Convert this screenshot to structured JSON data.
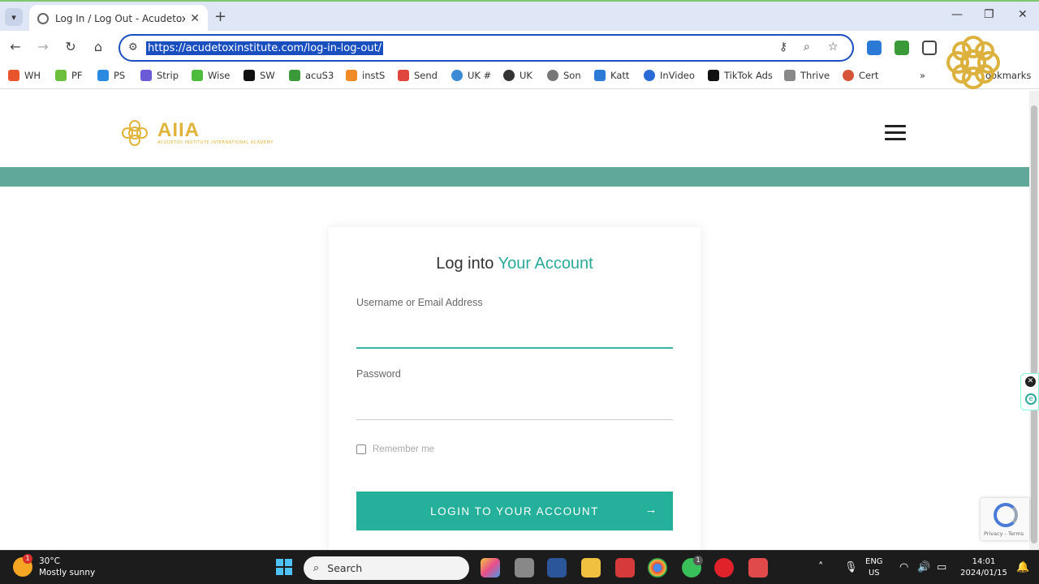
{
  "browser": {
    "tab_title": "Log In / Log Out - Acudetox In:",
    "url": "https://acudetoxinstitute.com/log-in-log-out/",
    "bookmarks": [
      {
        "label": "WH",
        "color": "#e8542b"
      },
      {
        "label": "PF",
        "color": "#6cbf3a"
      },
      {
        "label": "PS",
        "color": "#2a8ae0"
      },
      {
        "label": "Strip",
        "color": "#6b5bd6"
      },
      {
        "label": "Wise",
        "color": "#4dbb3c"
      },
      {
        "label": "SW",
        "color": "#111111"
      },
      {
        "label": "acuS3",
        "color": "#3a9a3a"
      },
      {
        "label": "instS",
        "color": "#f08a24"
      },
      {
        "label": "Send",
        "color": "#e0463c"
      },
      {
        "label": "UK #",
        "color": "#3a8ad6"
      },
      {
        "label": "UK",
        "color": "#333333"
      },
      {
        "label": "Son",
        "color": "#777777"
      },
      {
        "label": "Katt",
        "color": "#2a7ad6"
      },
      {
        "label": "InVideo",
        "color": "#2a6ad6"
      },
      {
        "label": "TikTok Ads",
        "color": "#111111"
      },
      {
        "label": "Thrive",
        "color": "#888888"
      },
      {
        "label": "Cert",
        "color": "#d6553a"
      }
    ],
    "bookmarks_more": "»",
    "all_bookmarks": "ookmarks"
  },
  "site": {
    "logo_text": "AIIA",
    "logo_sub": "ACUDETOX INSTITUTE INTERNATIONAL ACADEMY"
  },
  "login": {
    "title_plain": "Log into ",
    "title_accent": "Your Account",
    "username_label": "Username or Email Address",
    "password_label": "Password",
    "remember_label": "Remember me",
    "button_label": "LOGIN TO YOUR ACCOUNT",
    "button_arrow": "→"
  },
  "recaptcha": {
    "text": "Privacy - Terms"
  },
  "taskbar": {
    "weather_temp": "30°C",
    "weather_desc": "Mostly sunny",
    "weather_badge": "1",
    "search_label": "Search",
    "whatsapp_badge": "1",
    "lang_1": "ENG",
    "lang_2": "US",
    "time": "14:01",
    "date": "2024/01/15"
  },
  "colors": {
    "accent_teal": "#2ba99b",
    "button_teal": "#25b09b",
    "band_teal": "#5fa89a",
    "logo_gold": "#e0b33a"
  }
}
